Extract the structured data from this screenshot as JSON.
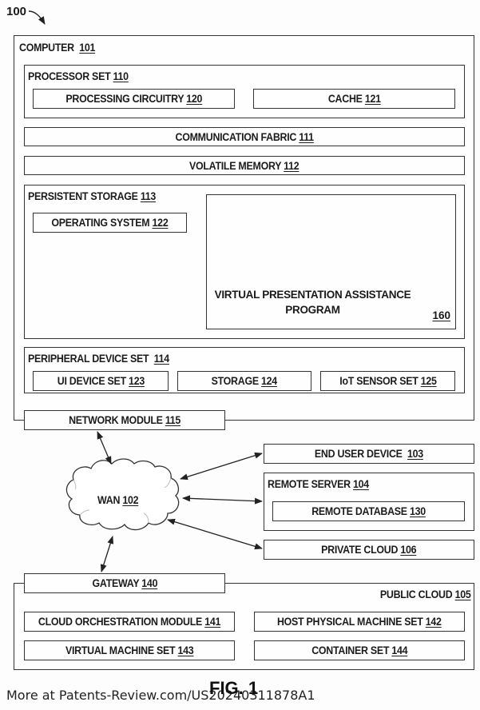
{
  "figure_ref": "100",
  "computer": {
    "label": "COMPUTER",
    "num": "101"
  },
  "processor_set": {
    "label": "PROCESSOR SET",
    "num": "110"
  },
  "processing_circuitry": {
    "label": "PROCESSING CIRCUITRY",
    "num": "120"
  },
  "cache": {
    "label": "CACHE",
    "num": "121"
  },
  "communication_fabric": {
    "label": "COMMUNICATION FABRIC",
    "num": "111"
  },
  "volatile_memory": {
    "label": "VOLATILE MEMORY",
    "num": "112"
  },
  "persistent_storage": {
    "label": "PERSISTENT STORAGE",
    "num": "113"
  },
  "operating_system": {
    "label": "OPERATING SYSTEM",
    "num": "122"
  },
  "vpa_program": {
    "label_line1": "VIRTUAL PRESENTATION ASSISTANCE",
    "label_line2": "PROGRAM",
    "num": "160"
  },
  "peripheral_device_set": {
    "label": "PERIPHERAL DEVICE SET",
    "num": "114"
  },
  "ui_device_set": {
    "label": "UI DEVICE SET",
    "num": "123"
  },
  "storage": {
    "label": "STORAGE",
    "num": "124"
  },
  "iot_sensor_set": {
    "label": "IoT SENSOR SET",
    "num": "125"
  },
  "network_module": {
    "label": "NETWORK MODULE",
    "num": "115"
  },
  "wan": {
    "label": "WAN",
    "num": "102"
  },
  "end_user_device": {
    "label": "END USER DEVICE",
    "num": "103"
  },
  "remote_server": {
    "label": "REMOTE SERVER",
    "num": "104"
  },
  "remote_database": {
    "label": "REMOTE DATABASE",
    "num": "130"
  },
  "private_cloud": {
    "label": "PRIVATE CLOUD",
    "num": "106"
  },
  "gateway": {
    "label": "GATEWAY",
    "num": "140"
  },
  "public_cloud": {
    "label": "PUBLIC CLOUD",
    "num": "105"
  },
  "cloud_orchestration_module": {
    "label": "CLOUD ORCHESTRATION MODULE",
    "num": "141"
  },
  "host_physical_machine_set": {
    "label": "HOST PHYSICAL MACHINE SET",
    "num": "142"
  },
  "virtual_machine_set": {
    "label": "VIRTUAL MACHINE SET",
    "num": "143"
  },
  "container_set": {
    "label": "CONTAINER SET",
    "num": "144"
  },
  "fig_caption": "FIG. 1",
  "footer_text": "More at Patents-Review.com/US20240311878A1"
}
